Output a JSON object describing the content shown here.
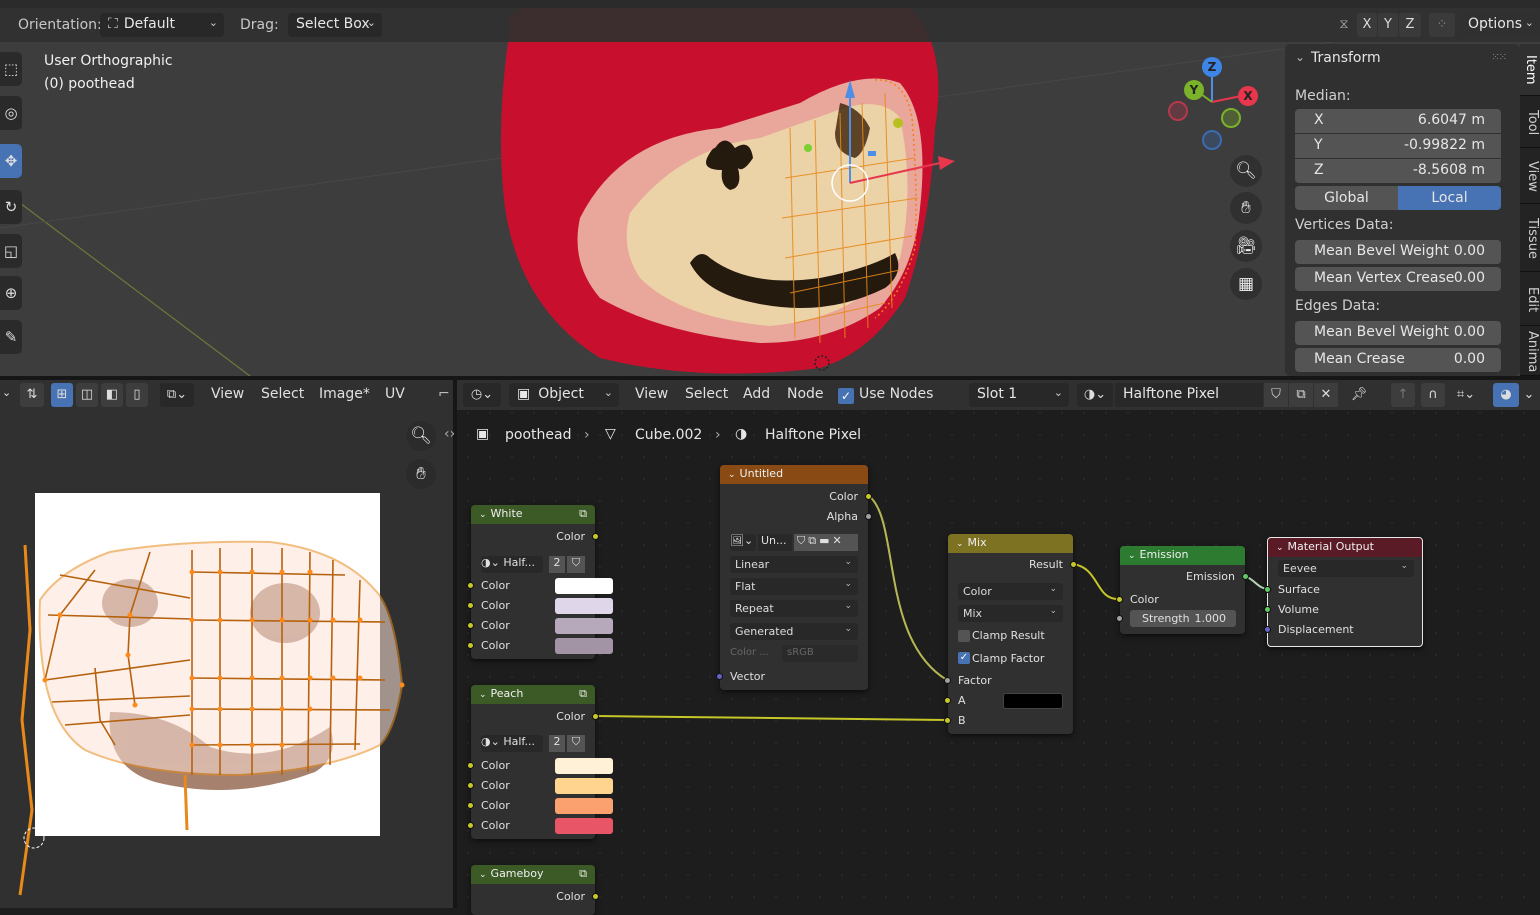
{
  "viewport": {
    "header": {
      "orientation_label": "Orientation:",
      "orientation_value": "Default",
      "drag_label": "Drag:",
      "drag_value": "Select Box",
      "axis_x": "X",
      "axis_y": "Y",
      "axis_z": "Z",
      "options_label": "Options"
    },
    "view_name": "User Orthographic",
    "object_info": "(0) poothead",
    "gizmo": {
      "z": "Z",
      "y": "Y",
      "x": "X"
    },
    "nav_icons": [
      "zoom-icon",
      "hand-pan-icon",
      "camera-icon",
      "grid-icon"
    ],
    "tools": [
      "select-box-icon",
      "cursor-icon",
      "move-icon",
      "rotate-icon",
      "scale-icon",
      "transform-icon",
      "annotate-icon"
    ],
    "active_tool_index": 2
  },
  "n_panel": {
    "panel_title": "Transform",
    "median_label": "Median:",
    "x": {
      "label": "X",
      "value": "6.6047 m"
    },
    "y": {
      "label": "Y",
      "value": "-0.99822 m"
    },
    "z": {
      "label": "Z",
      "value": "-8.5608 m"
    },
    "global_label": "Global",
    "local_label": "Local",
    "active_space": "Local",
    "vertices_section": "Vertices Data:",
    "vertex_bevel": {
      "label": "Mean Bevel Weight",
      "value": "0.00"
    },
    "vertex_crease": {
      "label": "Mean Vertex Crease",
      "value": "0.00"
    },
    "edges_section": "Edges Data:",
    "edge_bevel": {
      "label": "Mean Bevel Weight",
      "value": "0.00"
    },
    "edge_crease": {
      "label": "Mean Crease",
      "value": "0.00"
    },
    "tabs": [
      "Item",
      "Tool",
      "View",
      "Tissue",
      "Edit",
      "Anima"
    ],
    "active_tab": "Item"
  },
  "uv_editor": {
    "menus": [
      "View",
      "Select",
      "Image*",
      "UV"
    ]
  },
  "node_editor": {
    "header": {
      "mode": "Object",
      "menus": [
        "View",
        "Select",
        "Add",
        "Node"
      ],
      "use_nodes_label": "Use Nodes",
      "use_nodes_checked": true,
      "slot": "Slot 1",
      "material_name": "Halftone Pixel"
    },
    "breadcrumb": [
      "poothead",
      "Cube.002",
      "Halftone Pixel"
    ],
    "nodes": {
      "white": {
        "title": "White",
        "output": "Color",
        "group_name": "Half...",
        "users": "2",
        "inputs": [
          {
            "label": "Color",
            "color": "#ffffff"
          },
          {
            "label": "Color",
            "color": "#e0d6e9"
          },
          {
            "label": "Color",
            "color": "#b6a9bb"
          },
          {
            "label": "Color",
            "color": "#a294a5"
          }
        ]
      },
      "peach": {
        "title": "Peach",
        "output": "Color",
        "group_name": "Half...",
        "users": "2",
        "inputs": [
          {
            "label": "Color",
            "color": "#fff1d7"
          },
          {
            "label": "Color",
            "color": "#ffd48e"
          },
          {
            "label": "Color",
            "color": "#fba06f"
          },
          {
            "label": "Color",
            "color": "#e75566"
          }
        ]
      },
      "gameboy": {
        "title": "Gameboy",
        "output": "Color"
      },
      "image": {
        "title": "Untitled",
        "outputs": [
          "Color",
          "Alpha"
        ],
        "image_name": "Un...",
        "interpolation": "Linear",
        "projection": "Flat",
        "extension": "Repeat",
        "source": "Generated",
        "color_space_label": "Color ...",
        "color_space": "sRGB",
        "input": "Vector"
      },
      "mix": {
        "title": "Mix",
        "output": "Result",
        "data_type": "Color",
        "blend_mode": "Mix",
        "clamp_result_label": "Clamp Result",
        "clamp_result": false,
        "clamp_factor_label": "Clamp Factor",
        "clamp_factor": true,
        "inputs": [
          "Factor",
          "A",
          "B"
        ],
        "a_color": "#000000"
      },
      "emission": {
        "title": "Emission",
        "output": "Emission",
        "color_label": "Color",
        "strength_label": "Strength",
        "strength_value": "1.000"
      },
      "output": {
        "title": "Material Output",
        "target": "Eevee",
        "inputs": [
          "Surface",
          "Volume",
          "Displacement"
        ]
      }
    }
  },
  "colors": {
    "accent_blue": "#4772b3",
    "group_header": "#3b5a25",
    "texture_header": "#8a4a14",
    "mix_header": "#7c7222",
    "shader_header": "#2d7a31",
    "output_header": "#5a1a26"
  }
}
